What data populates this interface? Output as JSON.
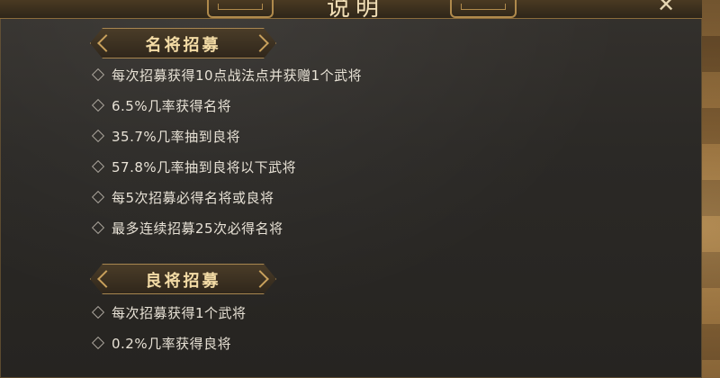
{
  "dialog": {
    "title": "说明",
    "close_glyph": "✕"
  },
  "sections": [
    {
      "title": "名将招募",
      "rules": [
        "每次招募获得10点战法点并获赠1个武将",
        "6.5%几率获得名将",
        "35.7%几率抽到良将",
        "57.8%几率抽到良将以下武将",
        "每5次招募必得名将或良将",
        "最多连续招募25次必得名将"
      ]
    },
    {
      "title": "良将招募",
      "rules": [
        "每次招募获得1个武将",
        "0.2%几率获得良将"
      ]
    }
  ],
  "colors": {
    "accent_gold": "#c9a15c",
    "text_light": "#e8e2d6",
    "panel_bg": "#2b2926"
  }
}
